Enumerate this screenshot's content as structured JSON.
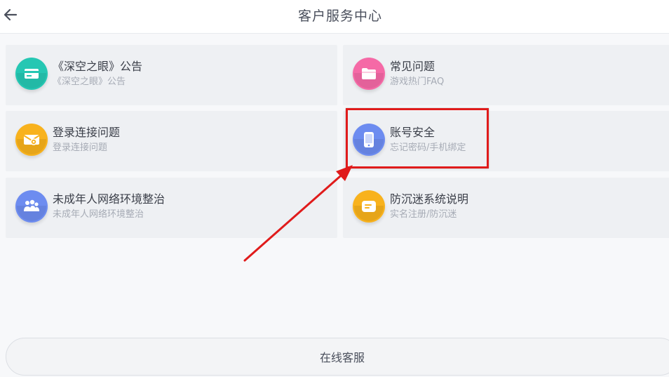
{
  "header": {
    "title": "客户服务中心",
    "back_icon": "arrow-left-icon"
  },
  "cards": [
    {
      "title": "《深空之眼》公告",
      "subtitle": "《深空之眼》公告",
      "icon": "card-icon",
      "color": "#25c7b3"
    },
    {
      "title": "常见问题",
      "subtitle": "游戏热门FAQ",
      "icon": "folder-icon",
      "color": "#f569a6"
    },
    {
      "title": "登录连接问题",
      "subtitle": "登录连接问题",
      "icon": "envelope-icon",
      "color": "#f8b21d"
    },
    {
      "title": "账号安全",
      "subtitle": "忘记密码/手机绑定",
      "icon": "phone-icon",
      "color": "#6d8cf0"
    },
    {
      "title": "未成年人网络环境整治",
      "subtitle": "未成年人网络环境整治",
      "icon": "users-icon",
      "color": "#6d8cf0"
    },
    {
      "title": "防沉迷系统说明",
      "subtitle": "实名注册/防沉迷",
      "icon": "message-icon",
      "color": "#f8b21d"
    }
  ],
  "bottom_button": {
    "label": "在线客服"
  },
  "annotation": {
    "color": "#e01b1b"
  }
}
